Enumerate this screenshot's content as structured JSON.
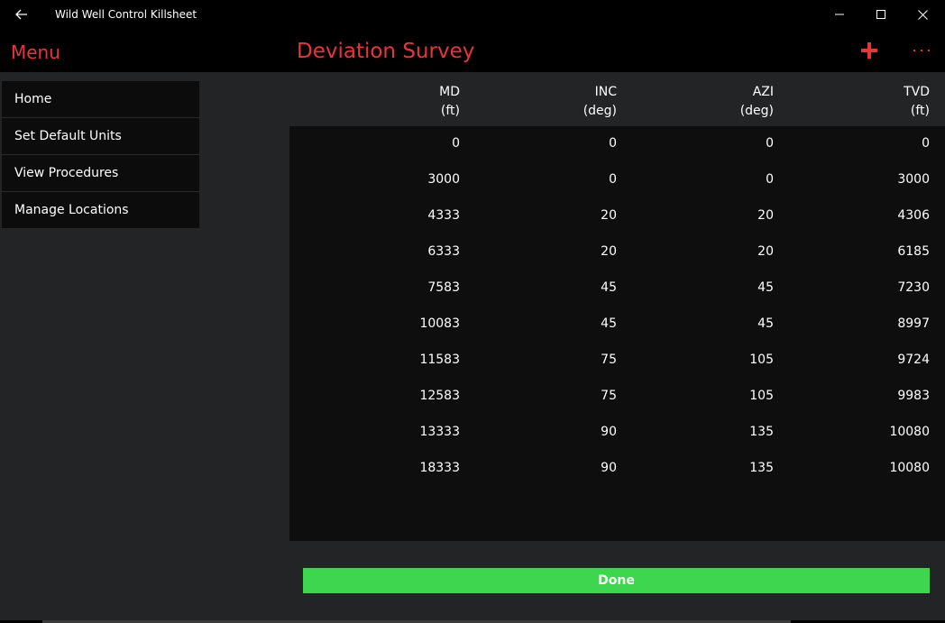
{
  "window": {
    "title": "Wild Well Control Killsheet"
  },
  "header": {
    "menu_label": "Menu",
    "page_title": "Deviation Survey"
  },
  "sidebar": {
    "items": [
      {
        "label": "Home"
      },
      {
        "label": "Set Default Units"
      },
      {
        "label": "View Procedures"
      },
      {
        "label": "Manage Locations"
      }
    ]
  },
  "table": {
    "columns": [
      {
        "name": "MD",
        "unit": "(ft)"
      },
      {
        "name": "INC",
        "unit": "(deg)"
      },
      {
        "name": "AZI",
        "unit": "(deg)"
      },
      {
        "name": "TVD",
        "unit": "(ft)"
      }
    ],
    "rows": [
      {
        "md": "0",
        "inc": "0",
        "azi": "0",
        "tvd": "0"
      },
      {
        "md": "3000",
        "inc": "0",
        "azi": "0",
        "tvd": "3000"
      },
      {
        "md": "4333",
        "inc": "20",
        "azi": "20",
        "tvd": "4306"
      },
      {
        "md": "6333",
        "inc": "20",
        "azi": "20",
        "tvd": "6185"
      },
      {
        "md": "7583",
        "inc": "45",
        "azi": "45",
        "tvd": "7230"
      },
      {
        "md": "10083",
        "inc": "45",
        "azi": "45",
        "tvd": "8997"
      },
      {
        "md": "11583",
        "inc": "75",
        "azi": "105",
        "tvd": "9724"
      },
      {
        "md": "12583",
        "inc": "75",
        "azi": "105",
        "tvd": "9983"
      },
      {
        "md": "13333",
        "inc": "90",
        "azi": "135",
        "tvd": "10080"
      },
      {
        "md": "18333",
        "inc": "90",
        "azi": "135",
        "tvd": "10080"
      }
    ]
  },
  "actions": {
    "done_label": "Done"
  },
  "icons": {
    "back": "back-arrow-icon",
    "minimize": "minimize-icon",
    "maximize": "maximize-icon",
    "close": "close-icon",
    "add": "plus-icon",
    "more": "more-ellipsis-icon"
  },
  "colors": {
    "accent": "#e8343a",
    "done": "#3ed64e",
    "background": "#232426",
    "panel": "#0e0e0e"
  }
}
